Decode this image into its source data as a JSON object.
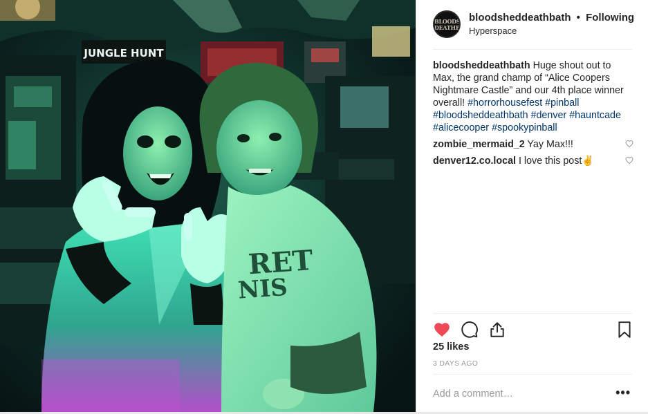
{
  "post": {
    "header": {
      "avatar_text_line1": "BLOODSHED",
      "avatar_text_line2": "DEATHBATH",
      "username": "bloodsheddeathbath",
      "separator": "•",
      "follow_status": "Following",
      "location": "Hyperspace"
    },
    "photo": {
      "alt": "Two people posing in a dim arcade lit with green and purple light",
      "arcade_marquee": "JUNGLE HUNT",
      "shirt_text_line1": "RET",
      "shirt_text_line2": "NIS"
    },
    "caption": {
      "username": "bloodsheddeathbath",
      "text": "Huge shout out to Max, the grand champ of “Alice Coopers Nightmare Castle” and our 4th place winner overall!",
      "hashtags": [
        "#horrorhousefest",
        "#pinball",
        "#bloodsheddeathbath",
        "#denver",
        "#hauntcade",
        "#alicecooper",
        "#spookypinball"
      ]
    },
    "comments": [
      {
        "username": "zombie_mermaid_2",
        "text": "Yay Max!!!"
      },
      {
        "username": "denver12.co.local",
        "text": "I love this post✌️"
      }
    ],
    "actions": {
      "like_icon": "heart-filled-icon",
      "comment_icon": "comment-bubble-icon",
      "share_icon": "share-upload-icon",
      "save_icon": "bookmark-icon"
    },
    "likes_text": "25 likes",
    "date_text": "3 DAYS AGO",
    "add_comment": {
      "placeholder": "Add a comment…",
      "more_label": "•••"
    },
    "colors": {
      "like_red": "#ed4956",
      "hashtag_blue": "#003569",
      "muted_text": "#999999",
      "photo_green": "#2fd6a0"
    }
  }
}
